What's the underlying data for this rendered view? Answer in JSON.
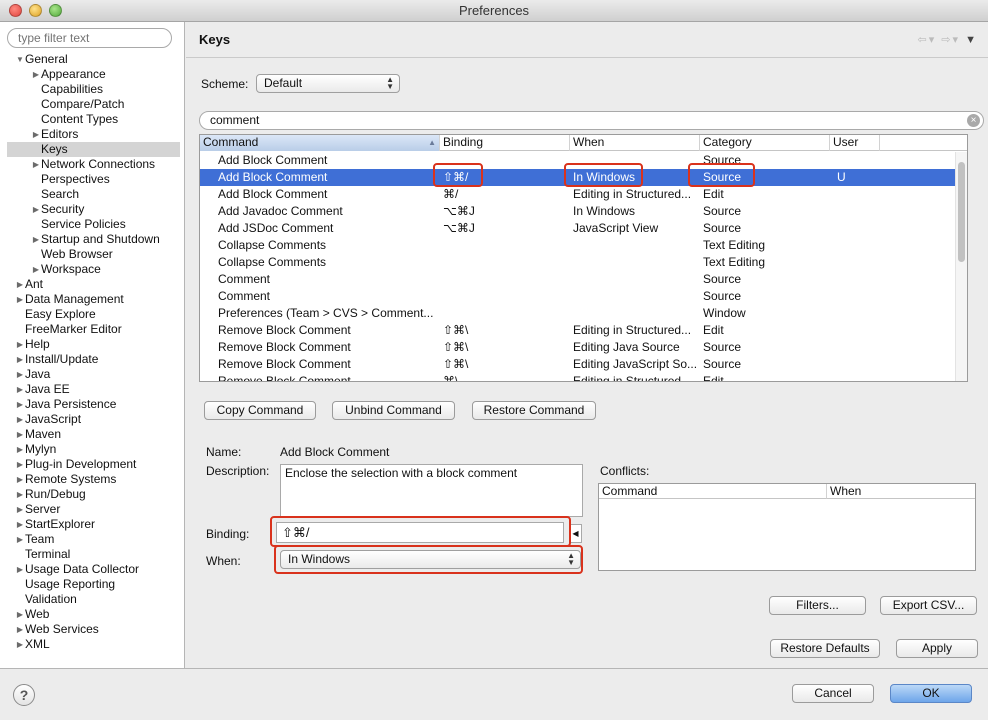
{
  "window": {
    "title": "Preferences"
  },
  "filter": {
    "placeholder": "type filter text"
  },
  "tree": [
    {
      "label": "General",
      "expanded": true,
      "level": 0
    },
    {
      "label": "Appearance",
      "expandable": true,
      "level": 1
    },
    {
      "label": "Capabilities",
      "level": 1
    },
    {
      "label": "Compare/Patch",
      "level": 1
    },
    {
      "label": "Content Types",
      "level": 1
    },
    {
      "label": "Editors",
      "expandable": true,
      "level": 1
    },
    {
      "label": "Keys",
      "level": 1,
      "selected": true
    },
    {
      "label": "Network Connections",
      "expandable": true,
      "level": 1
    },
    {
      "label": "Perspectives",
      "level": 1
    },
    {
      "label": "Search",
      "level": 1
    },
    {
      "label": "Security",
      "expandable": true,
      "level": 1
    },
    {
      "label": "Service Policies",
      "level": 1
    },
    {
      "label": "Startup and Shutdown",
      "expandable": true,
      "level": 1
    },
    {
      "label": "Web Browser",
      "level": 1
    },
    {
      "label": "Workspace",
      "expandable": true,
      "level": 1
    },
    {
      "label": "Ant",
      "expandable": true,
      "level": 0
    },
    {
      "label": "Data Management",
      "expandable": true,
      "level": 0
    },
    {
      "label": "Easy Explore",
      "level": 0
    },
    {
      "label": "FreeMarker Editor",
      "level": 0
    },
    {
      "label": "Help",
      "expandable": true,
      "level": 0
    },
    {
      "label": "Install/Update",
      "expandable": true,
      "level": 0
    },
    {
      "label": "Java",
      "expandable": true,
      "level": 0
    },
    {
      "label": "Java EE",
      "expandable": true,
      "level": 0
    },
    {
      "label": "Java Persistence",
      "expandable": true,
      "level": 0
    },
    {
      "label": "JavaScript",
      "expandable": true,
      "level": 0
    },
    {
      "label": "Maven",
      "expandable": true,
      "level": 0
    },
    {
      "label": "Mylyn",
      "expandable": true,
      "level": 0
    },
    {
      "label": "Plug-in Development",
      "expandable": true,
      "level": 0
    },
    {
      "label": "Remote Systems",
      "expandable": true,
      "level": 0
    },
    {
      "label": "Run/Debug",
      "expandable": true,
      "level": 0
    },
    {
      "label": "Server",
      "expandable": true,
      "level": 0
    },
    {
      "label": "StartExplorer",
      "expandable": true,
      "level": 0
    },
    {
      "label": "Team",
      "expandable": true,
      "level": 0
    },
    {
      "label": "Terminal",
      "level": 0
    },
    {
      "label": "Usage Data Collector",
      "expandable": true,
      "level": 0
    },
    {
      "label": "Usage Reporting",
      "level": 0
    },
    {
      "label": "Validation",
      "level": 0
    },
    {
      "label": "Web",
      "expandable": true,
      "level": 0
    },
    {
      "label": "Web Services",
      "expandable": true,
      "level": 0
    },
    {
      "label": "XML",
      "expandable": true,
      "level": 0
    }
  ],
  "page": {
    "title": "Keys"
  },
  "scheme": {
    "label": "Scheme:",
    "value": "Default"
  },
  "search": {
    "value": "comment"
  },
  "table": {
    "columns": [
      "Command",
      "Binding",
      "When",
      "Category",
      "User"
    ],
    "rows": [
      {
        "command": "Add Block Comment",
        "binding": "",
        "when": "",
        "category": "Source",
        "user": ""
      },
      {
        "command": "Add Block Comment",
        "binding": "⇧⌘/",
        "when": "In Windows",
        "category": "Source",
        "user": "U",
        "selected": true
      },
      {
        "command": "Add Block Comment",
        "binding": "⌘/",
        "when": "Editing in Structured...",
        "category": "Edit",
        "user": ""
      },
      {
        "command": "Add Javadoc Comment",
        "binding": "⌥⌘J",
        "when": "In Windows",
        "category": "Source",
        "user": ""
      },
      {
        "command": "Add JSDoc Comment",
        "binding": "⌥⌘J",
        "when": "JavaScript View",
        "category": "Source",
        "user": ""
      },
      {
        "command": "Collapse Comments",
        "binding": "",
        "when": "",
        "category": "Text Editing",
        "user": ""
      },
      {
        "command": "Collapse Comments",
        "binding": "",
        "when": "",
        "category": "Text Editing",
        "user": ""
      },
      {
        "command": "Comment",
        "binding": "",
        "when": "",
        "category": "Source",
        "user": ""
      },
      {
        "command": "Comment",
        "binding": "",
        "when": "",
        "category": "Source",
        "user": ""
      },
      {
        "command": "Preferences (Team > CVS > Comment...",
        "binding": "",
        "when": "",
        "category": "Window",
        "user": ""
      },
      {
        "command": "Remove Block Comment",
        "binding": "⇧⌘\\",
        "when": "Editing in Structured...",
        "category": "Edit",
        "user": ""
      },
      {
        "command": "Remove Block Comment",
        "binding": "⇧⌘\\",
        "when": "Editing Java Source",
        "category": "Source",
        "user": ""
      },
      {
        "command": "Remove Block Comment",
        "binding": "⇧⌘\\",
        "when": "Editing JavaScript So...",
        "category": "Source",
        "user": ""
      },
      {
        "command": "Remove Block Comment",
        "binding": "⌘\\",
        "when": "Editing in Structured...",
        "category": "Edit",
        "user": ""
      }
    ]
  },
  "buttons": {
    "copy": "Copy Command",
    "unbind": "Unbind Command",
    "restore": "Restore Command",
    "filters": "Filters...",
    "export": "Export CSV...",
    "restore_defaults": "Restore Defaults",
    "apply": "Apply",
    "cancel": "Cancel",
    "ok": "OK"
  },
  "details": {
    "name_label": "Name:",
    "name_value": "Add Block Comment",
    "description_label": "Description:",
    "description_value": "Enclose the selection with a block comment",
    "binding_label": "Binding:",
    "binding_value": "⇧⌘/",
    "when_label": "When:",
    "when_value": "In Windows"
  },
  "conflicts": {
    "label": "Conflicts:",
    "columns": [
      "Command",
      "When"
    ]
  },
  "colors": {
    "selection": "#3f6fd6",
    "highlight": "#d9321c"
  },
  "icons": {
    "help": "?"
  }
}
